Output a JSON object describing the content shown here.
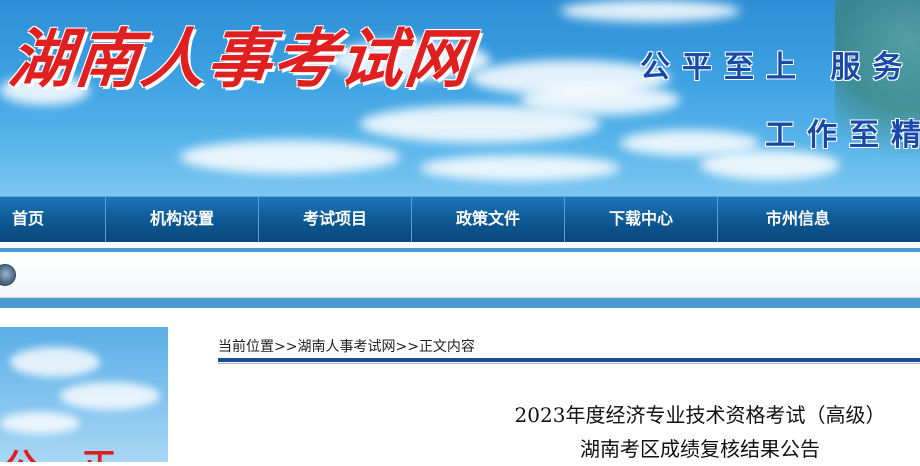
{
  "header": {
    "site_title": "湖南人事考试网",
    "slogan_line1": "公平至上 服务",
    "slogan_line2": "工作至精"
  },
  "nav": {
    "items": [
      {
        "label": "首页"
      },
      {
        "label": "机构设置"
      },
      {
        "label": "考试项目"
      },
      {
        "label": "政策文件"
      },
      {
        "label": "下载中心"
      },
      {
        "label": "市州信息"
      }
    ]
  },
  "notice_bar": {
    "icon": "speaker-icon"
  },
  "sidebar": {
    "image_text": "公 正"
  },
  "breadcrumb": {
    "prefix": "当前位置",
    "sep1": ">>",
    "home": "湖南人事考试网",
    "sep2": ">>",
    "current": "正文内容"
  },
  "article": {
    "title_line1": "2023年度经济专业技术资格考试（高级）",
    "title_line2": "湖南考区成绩复核结果公告"
  },
  "colors": {
    "banner_sky": "#3a9ee0",
    "title_red": "#e02020",
    "slogan_blue": "#1a4aa8",
    "nav_blue": "#0f5c98",
    "breadcrumb_rule": "#1c4d93"
  }
}
